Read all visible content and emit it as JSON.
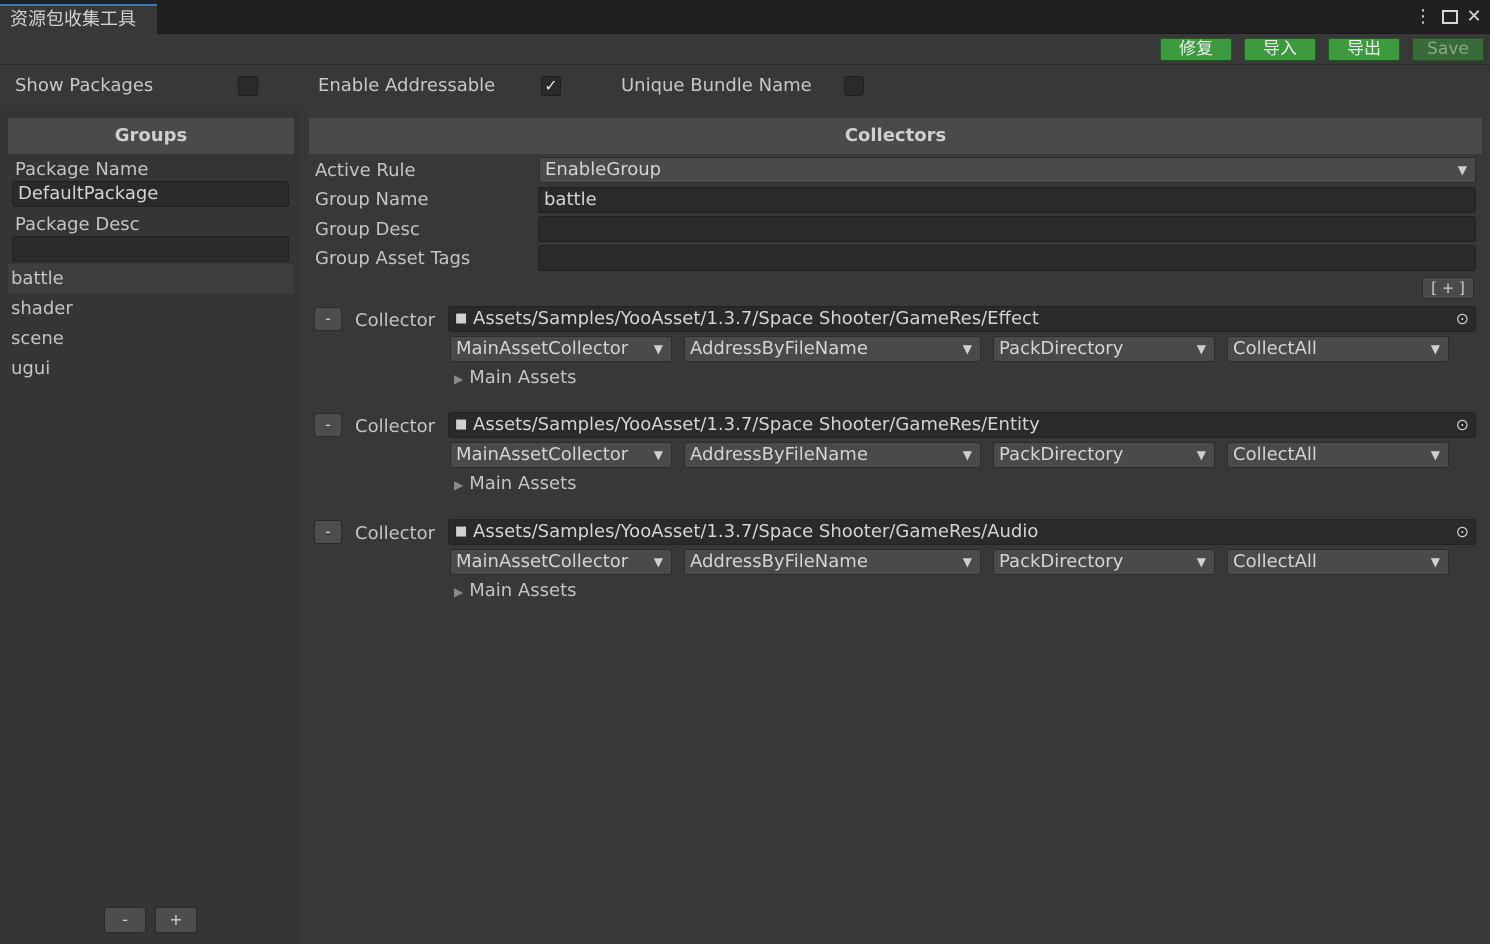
{
  "window": {
    "tab_title": "资源包收集工具",
    "menu_icon": "kebab-menu-icon",
    "maximize_icon": "maximize-icon",
    "close_icon": "close-icon"
  },
  "toolbar": {
    "fix_label": "修复",
    "import_label": "导入",
    "export_label": "导出",
    "save_label": "Save"
  },
  "options": {
    "show_packages_label": "Show Packages",
    "show_packages_checked": false,
    "enable_addressable_label": "Enable Addressable",
    "enable_addressable_checked": true,
    "unique_bundle_name_label": "Unique Bundle Name",
    "unique_bundle_name_checked": false,
    "check_mark": "✓"
  },
  "groups": {
    "header": "Groups",
    "package_name_label": "Package Name",
    "package_name_value": "DefaultPackage",
    "package_desc_label": "Package Desc",
    "package_desc_value": "",
    "items": [
      "battle",
      "shader",
      "scene",
      "ugui"
    ],
    "selected_index": 0,
    "remove_label": "-",
    "add_label": "+"
  },
  "collectors": {
    "header": "Collectors",
    "active_rule_label": "Active Rule",
    "active_rule_value": "EnableGroup",
    "group_name_label": "Group Name",
    "group_name_value": "battle",
    "group_desc_label": "Group Desc",
    "group_desc_value": "",
    "group_tags_label": "Group Asset Tags",
    "group_tags_value": "",
    "add_collector_label": "[ + ]",
    "remove_label": "-",
    "collector_label": "Collector",
    "main_assets_label": "Main Assets",
    "items": [
      {
        "path": "Assets/Samples/YooAsset/1.3.7/Space Shooter/GameRes/Effect",
        "collector_type": "MainAssetCollector",
        "address_rule": "AddressByFileName",
        "pack_rule": "PackDirectory",
        "filter_rule": "CollectAll"
      },
      {
        "path": "Assets/Samples/YooAsset/1.3.7/Space Shooter/GameRes/Entity",
        "collector_type": "MainAssetCollector",
        "address_rule": "AddressByFileName",
        "pack_rule": "PackDirectory",
        "filter_rule": "CollectAll"
      },
      {
        "path": "Assets/Samples/YooAsset/1.3.7/Space Shooter/GameRes/Audio",
        "collector_type": "MainAssetCollector",
        "address_rule": "AddressByFileName",
        "pack_rule": "PackDirectory",
        "filter_rule": "CollectAll"
      }
    ]
  },
  "colors": {
    "accent_green": "#3e9a3e",
    "tab_accent": "#3a79bb"
  }
}
